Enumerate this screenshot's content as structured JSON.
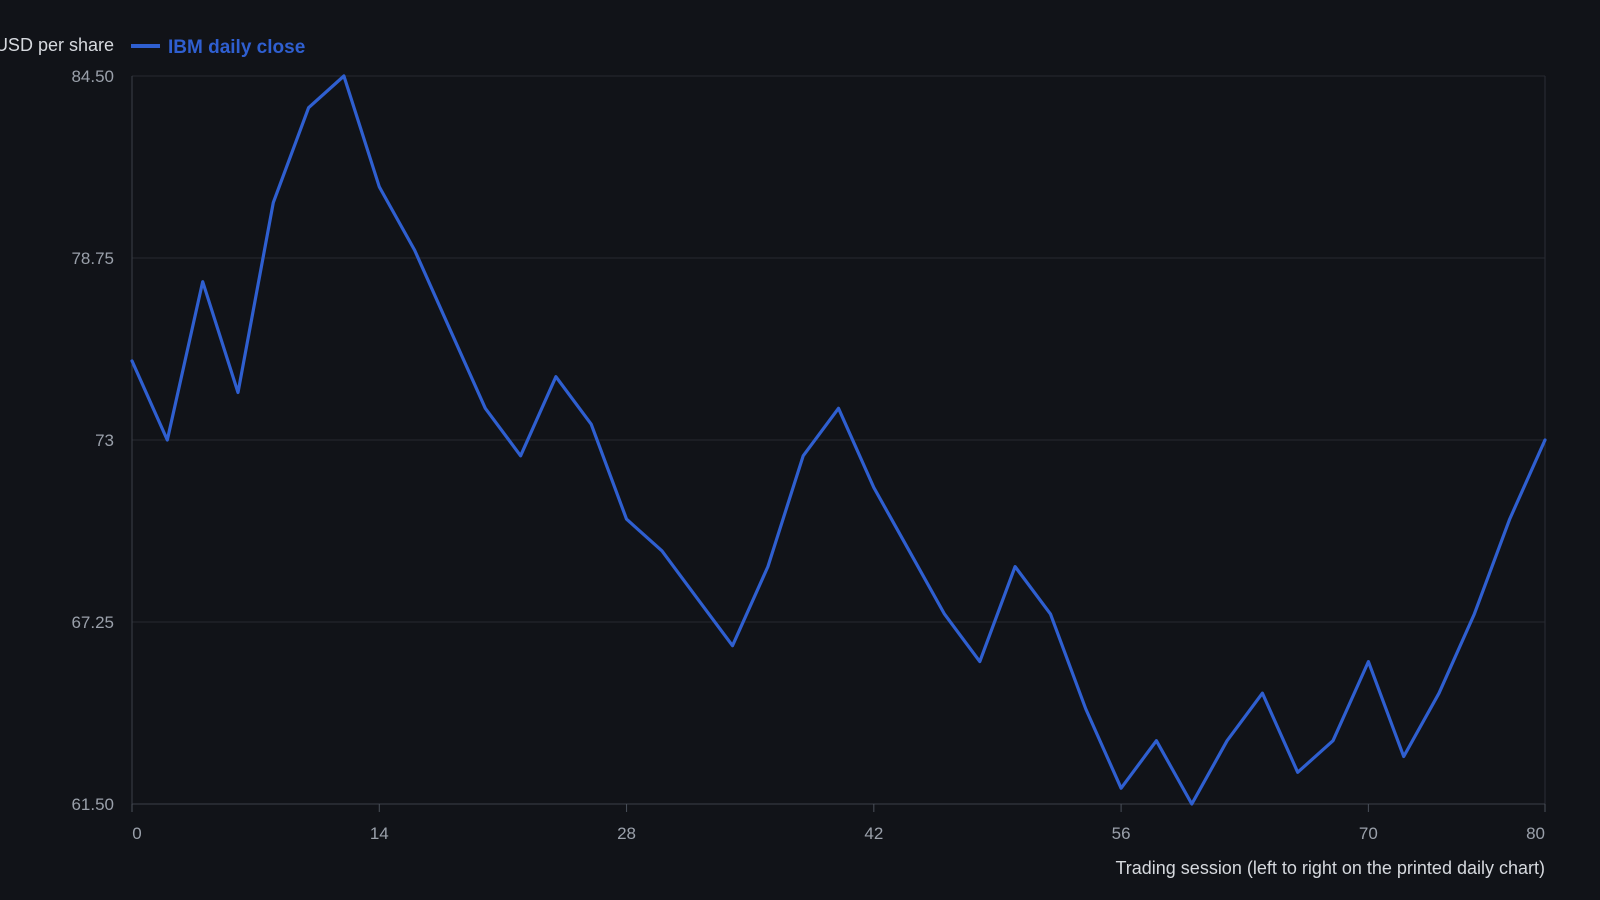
{
  "chart_data": {
    "type": "line",
    "ylabel": "USD per share",
    "xlabel": "Trading session (left to right on the printed daily chart)",
    "legend_position": "top-left",
    "grid": true,
    "xlim": [
      0,
      80
    ],
    "ylim": [
      61.5,
      84.5
    ],
    "x_ticks": [
      0,
      14,
      28,
      42,
      56,
      70,
      80
    ],
    "y_ticks": [
      61.5,
      67.25,
      73,
      78.75,
      84.5
    ],
    "x_tick_labels": [
      "0",
      "14",
      "28",
      "42",
      "56",
      "70",
      "80"
    ],
    "y_tick_labels": [
      "61.50",
      "67.25",
      "73",
      "78.75",
      "84.50"
    ],
    "series": [
      {
        "name": "IBM daily close",
        "color": "#2f5fd0",
        "x": [
          0,
          2,
          4,
          6,
          8,
          10,
          12,
          14,
          16,
          18,
          20,
          22,
          24,
          26,
          28,
          30,
          32,
          34,
          36,
          38,
          40,
          42,
          44,
          46,
          48,
          50,
          52,
          54,
          56,
          58,
          60,
          62,
          64,
          66,
          68,
          70,
          72,
          74,
          76,
          78,
          80
        ],
        "values": [
          75.5,
          73.0,
          78.0,
          74.5,
          80.5,
          83.5,
          84.5,
          81.0,
          79.0,
          76.5,
          74.0,
          72.5,
          75.0,
          73.5,
          70.5,
          69.5,
          68.0,
          66.5,
          69.0,
          72.5,
          74.0,
          71.5,
          69.5,
          67.5,
          66.0,
          69.0,
          67.5,
          64.5,
          62.0,
          63.5,
          61.5,
          63.5,
          65.0,
          62.5,
          63.5,
          66.0,
          63.0,
          65.0,
          67.5,
          70.5,
          73.0
        ]
      }
    ]
  }
}
